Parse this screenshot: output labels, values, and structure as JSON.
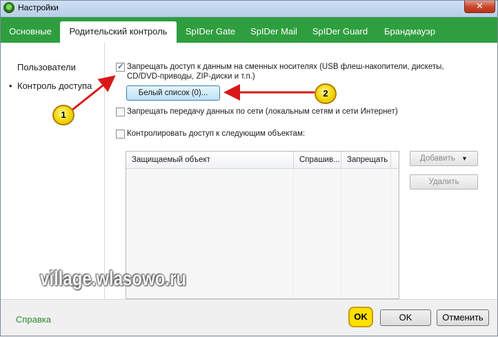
{
  "window": {
    "title": "Настройки",
    "close_glyph": "✕"
  },
  "tabs": [
    {
      "label": "Основные"
    },
    {
      "label": "Родительский контроль",
      "active": true
    },
    {
      "label": "SpIDer Gate"
    },
    {
      "label": "SpIDer Mail"
    },
    {
      "label": "SpIDer Guard"
    },
    {
      "label": "Брандмауэр"
    }
  ],
  "sidebar": {
    "items": [
      {
        "label": "Пользователи",
        "selected": false
      },
      {
        "label": "Контроль доступа",
        "selected": true,
        "bullet": "•"
      }
    ]
  },
  "options": {
    "removable_media": {
      "checked": true,
      "line1": "Запрещать доступ к данным на сменных носителях (USB флеш-накопители, дискеты,",
      "line2": "CD/DVD-приводы, ZIP-диски и т.п.)"
    },
    "whitelist_button": "Белый список (0)...",
    "network_transfer": {
      "checked": false,
      "label": "Запрещать передачу данных по сети (локальным сетям и сети Интернет)"
    },
    "control_objects": {
      "checked": false,
      "label": "Контролировать доступ к следующим объектам:"
    }
  },
  "table": {
    "columns": [
      "Защищаемый объект",
      "Спрашив...",
      "Запрещать"
    ],
    "rows": []
  },
  "side_buttons": {
    "add": "Добавить",
    "add_arrow": "▼",
    "remove": "Удалить"
  },
  "footer": {
    "help": "Справка",
    "ok": "OK",
    "cancel": "Отменить"
  },
  "annotations": {
    "badge1": "1",
    "badge2": "2",
    "ok_highlight": "OK",
    "arrow_color": "#d81818"
  },
  "watermark": "village.wlasowo.ru",
  "colors": {
    "tab_bar": "#2f9e3f",
    "help_link": "#2d8a2d",
    "highlight": "#ffe000"
  }
}
